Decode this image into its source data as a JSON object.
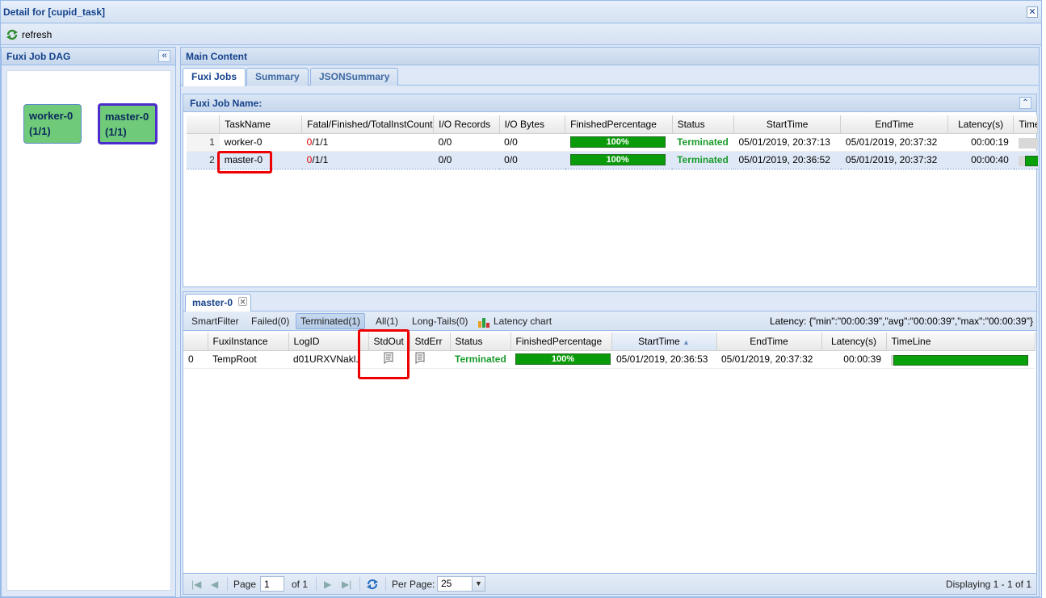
{
  "window": {
    "title": "Detail for [cupid_task]"
  },
  "toolbar": {
    "refresh_label": "refresh"
  },
  "left_panel": {
    "title": "Fuxi Job DAG",
    "nodes": [
      {
        "name": "worker-0",
        "count": "(1/1)"
      },
      {
        "name": "master-0",
        "count": "(1/1)"
      }
    ]
  },
  "main": {
    "title": "Main Content",
    "tabs": [
      "Fuxi Jobs",
      "Summary",
      "JSONSummary"
    ],
    "job_grid": {
      "title": "Fuxi Job Name:",
      "columns": [
        "TaskName",
        "Fatal/Finished/TotalInstCount",
        "I/O Records",
        "I/O Bytes",
        "FinishedPercentage",
        "Status",
        "StartTime",
        "EndTime",
        "Latency(s)",
        "TimeLine"
      ],
      "rows": [
        {
          "num": "1",
          "task": "worker-0",
          "fatal": "0",
          "rest": "/1/1",
          "records": "0/0",
          "bytes": "0/0",
          "pct": "100%",
          "status": "Terminated",
          "start": "05/01/2019, 20:37:13",
          "end": "05/01/2019, 20:37:32",
          "latency": "00:00:19"
        },
        {
          "num": "2",
          "task": "master-0",
          "fatal": "0",
          "rest": "/1/1",
          "records": "0/0",
          "bytes": "0/0",
          "pct": "100%",
          "status": "Terminated",
          "start": "05/01/2019, 20:36:52",
          "end": "05/01/2019, 20:37:32",
          "latency": "00:00:40"
        }
      ]
    },
    "instance_panel": {
      "tab_label": "master-0",
      "filters": [
        "SmartFilter",
        "Failed(0)",
        "Terminated(1)",
        "All(1)",
        "Long-Tails(0)"
      ],
      "latency_chart_label": "Latency chart",
      "latency_summary": "Latency: {\"min\":\"00:00:39\",\"avg\":\"00:00:39\",\"max\":\"00:00:39\"}",
      "columns": [
        "FuxiInstance",
        "LogID",
        "StdOut",
        "StdErr",
        "Status",
        "FinishedPercentage",
        "StartTime",
        "EndTime",
        "Latency(s)",
        "TimeLine"
      ],
      "rows": [
        {
          "idx": "0",
          "instance": "TempRoot",
          "logid": "d01URXVNakl..",
          "status": "Terminated",
          "pct": "100%",
          "start": "05/01/2019, 20:36:53",
          "end": "05/01/2019, 20:37:32",
          "latency": "00:00:39"
        }
      ]
    },
    "pager": {
      "page_label": "Page",
      "page_value": "1",
      "of_label": "of 1",
      "per_page_label": "Per Page:",
      "per_page_value": "25",
      "display_text": "Displaying 1 - 1 of 1"
    }
  },
  "colors": {
    "accent": "#15428b",
    "progress": "#0a9b0a",
    "status_ok": "#1a9b2b",
    "highlight": "#e00000",
    "selected_node_border": "#4c2ccd"
  }
}
